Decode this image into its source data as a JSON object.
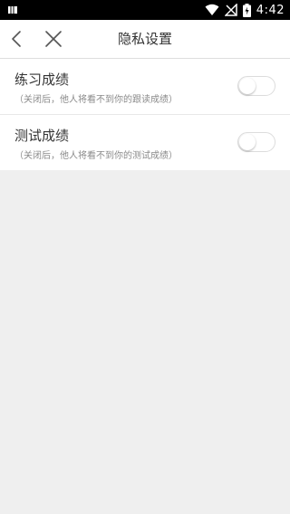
{
  "status_bar": {
    "time": "4:42",
    "icons": [
      "notification-icon",
      "wifi-icon",
      "no-signal-icon",
      "battery-charging-icon"
    ]
  },
  "nav": {
    "title": "隐私设置",
    "back_icon": "back-arrow-icon",
    "close_icon": "close-icon"
  },
  "settings": [
    {
      "title": "练习成绩",
      "description": "（关闭后，他人将看不到你的跟读成绩）",
      "enabled": false
    },
    {
      "title": "测试成绩",
      "description": "（关闭后，他人将看不到你的测试成绩）",
      "enabled": false
    }
  ],
  "colors": {
    "status_bar_bg": "#000000",
    "nav_bg": "#ffffff",
    "page_bg": "#efefef",
    "title_text": "#333333",
    "desc_text": "#8a8a8a"
  }
}
